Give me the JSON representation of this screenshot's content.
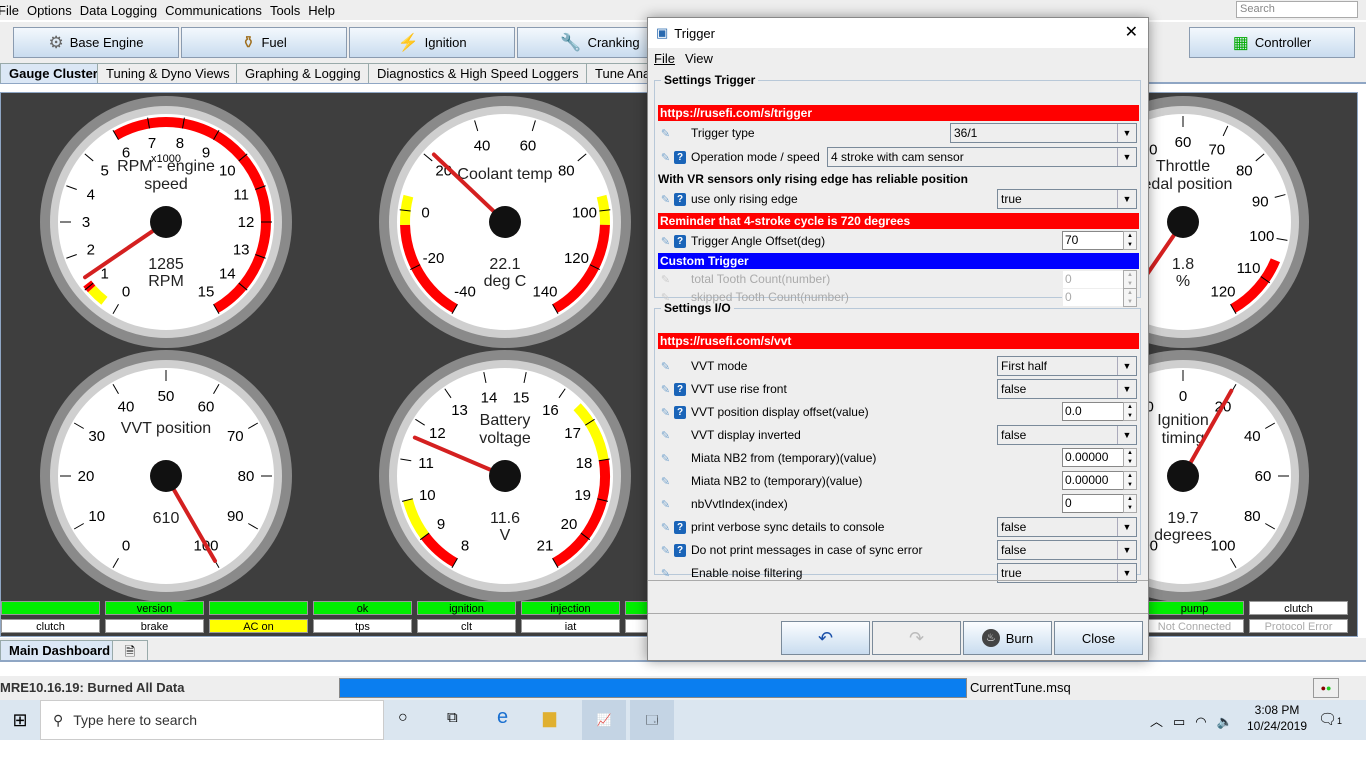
{
  "menubar": {
    "items": [
      "File",
      "Options",
      "Data Logging",
      "Communications",
      "Tools",
      "Help"
    ],
    "search_placeholder": "Search"
  },
  "toolbar": {
    "buttons": [
      {
        "label": "Base Engine",
        "icon": "gear-icon"
      },
      {
        "label": "Fuel",
        "icon": "injector-icon"
      },
      {
        "label": "Ignition",
        "icon": "spark-plug-icon"
      },
      {
        "label": "Cranking",
        "icon": "wrench-icon"
      },
      {
        "label": "Controller",
        "icon": "chip-icon"
      }
    ]
  },
  "tabs": [
    "Gauge Cluster",
    "Tuning & Dyno Views",
    "Graphing & Logging",
    "Diagnostics & High Speed Loggers",
    "Tune Ana"
  ],
  "gauges": [
    {
      "title": [
        "RPM - engine",
        "speed"
      ],
      "sub": "x1000",
      "value": "1285",
      "units": "RPM",
      "min": 0,
      "max": 15,
      "step": 1,
      "needle": 1.285,
      "zones": [
        {
          "from": 0.4,
          "to": 0.9,
          "color": "#ffff00"
        },
        {
          "from": 0.9,
          "to": 1.1,
          "color": "#ff0000"
        },
        {
          "from": 6,
          "to": 15,
          "color": "#ff0000"
        }
      ]
    },
    {
      "title": [
        "Coolant temp"
      ],
      "sub": "",
      "value": "22.1",
      "units": "deg C",
      "min": -40,
      "max": 140,
      "step": 20,
      "needle": 22.1,
      "zones": [
        {
          "from": -40,
          "to": -5,
          "color": "#ff0000"
        },
        {
          "from": -5,
          "to": 5,
          "color": "#ffff00"
        },
        {
          "from": 95,
          "to": 105,
          "color": "#ffff00"
        },
        {
          "from": 105,
          "to": 140,
          "color": "#ff0000"
        }
      ]
    },
    {
      "title": [
        "Throttle",
        "pedal position"
      ],
      "sub": "",
      "value": "1.8",
      "units": "%",
      "min": 0,
      "max": 120,
      "step": 10,
      "needle": 1.8,
      "zones": [
        {
          "from": 105,
          "to": 120,
          "color": "#ff0000"
        }
      ]
    },
    {
      "title": [
        "VVT position"
      ],
      "sub": "",
      "value": "610",
      "units": "",
      "min": 0,
      "max": 100,
      "step": 10,
      "needle": 100,
      "zones": []
    },
    {
      "title": [
        "Battery",
        "voltage"
      ],
      "sub": "",
      "value": "11.6",
      "units": "V",
      "min": 8,
      "max": 21,
      "step": 1,
      "needle": 11.6,
      "zones": [
        {
          "from": 8,
          "to": 9,
          "color": "#ff0000"
        },
        {
          "from": 9,
          "to": 10,
          "color": "#ffff00"
        },
        {
          "from": 16.5,
          "to": 18,
          "color": "#ffff00"
        },
        {
          "from": 18,
          "to": 21,
          "color": "#ff0000"
        }
      ]
    },
    {
      "title": [
        "Ignition",
        "timing"
      ],
      "sub": "",
      "value": "19.7",
      "units": "degrees",
      "min": -100,
      "max": 100,
      "step": 20,
      "needle": 19.7,
      "zones": []
    }
  ],
  "indicators": {
    "top": [
      {
        "label": "",
        "on": true
      },
      {
        "label": "version",
        "on": true
      },
      {
        "label": "",
        "on": true
      },
      {
        "label": "ok",
        "on": true
      },
      {
        "label": "ignition",
        "on": true
      },
      {
        "label": "injection",
        "on": true
      },
      {
        "label": "",
        "on": true
      },
      {
        "label": "pump",
        "on": true
      },
      {
        "label": "clutch",
        "on": false
      }
    ],
    "bottom": [
      {
        "label": "clutch",
        "state": "off"
      },
      {
        "label": "brake",
        "state": "off"
      },
      {
        "label": "AC on",
        "state": "warn"
      },
      {
        "label": "tps",
        "state": "off"
      },
      {
        "label": "clt",
        "state": "off"
      },
      {
        "label": "iat",
        "state": "off"
      },
      {
        "label": "",
        "state": "off"
      },
      {
        "label": "Not Connected",
        "state": "dis"
      },
      {
        "label": "Protocol Error",
        "state": "dis"
      }
    ]
  },
  "dash_tab": "Main Dashboard",
  "status": {
    "message": "MRE10.16.19: Burned All Data",
    "progress": 1.0,
    "file": "CurrentTune.msq"
  },
  "taskbar": {
    "search_placeholder": "Type here to search",
    "time": "3:08 PM",
    "date": "10/24/2019",
    "notifications": "1"
  },
  "dialog": {
    "title": "Trigger",
    "menu": [
      "File",
      "View"
    ],
    "section1": "Settings Trigger",
    "link1": "https://rusefi.com/s/trigger",
    "trigger_type": {
      "label": "Trigger type",
      "value": "36/1"
    },
    "op_mode": {
      "label": "Operation mode / speed",
      "value": "4 stroke with cam sensor"
    },
    "vr_note": "With VR sensors only rising edge has reliable position",
    "rising": {
      "label": "use only rising edge",
      "value": "true"
    },
    "reminder": "Reminder that 4-stroke cycle is 720 degrees",
    "angle_offset": {
      "label": "Trigger Angle Offset(deg)",
      "value": "70"
    },
    "custom": "Custom Trigger",
    "total_tooth": {
      "label": "total Tooth Count(number)",
      "value": "0"
    },
    "skipped_tooth": {
      "label": "skipped Tooth Count(number)",
      "value": "0"
    },
    "section2": "Settings I/O",
    "link2": "https://rusefi.com/s/vvt",
    "io_rows": [
      {
        "label": "VVT mode",
        "value": "First half",
        "type": "combo",
        "help": false
      },
      {
        "label": "VVT use rise front",
        "value": "false",
        "type": "combo",
        "help": true
      },
      {
        "label": "VVT position display offset(value)",
        "value": "0.0",
        "type": "spin",
        "help": true
      },
      {
        "label": "VVT display inverted",
        "value": "false",
        "type": "combo",
        "help": false
      },
      {
        "label": "Miata NB2 from (temporary)(value)",
        "value": "0.00000",
        "type": "spin",
        "help": false
      },
      {
        "label": "Miata NB2 to (temporary)(value)",
        "value": "0.00000",
        "type": "spin",
        "help": false
      },
      {
        "label": "nbVvtIndex(index)",
        "value": "0",
        "type": "spin",
        "help": false
      },
      {
        "label": "print verbose sync details to console",
        "value": "false",
        "type": "combo",
        "help": true
      },
      {
        "label": "Do not print messages in case of sync error",
        "value": "false",
        "type": "combo",
        "help": true
      },
      {
        "label": "Enable noise filtering",
        "value": "true",
        "type": "combo",
        "help": false
      }
    ],
    "buttons": {
      "burn": "Burn",
      "close": "Close"
    },
    "colors": {
      "red_bar": "#ff0000",
      "blue_bar": "#0000ff",
      "help": "#1a64b8"
    }
  }
}
